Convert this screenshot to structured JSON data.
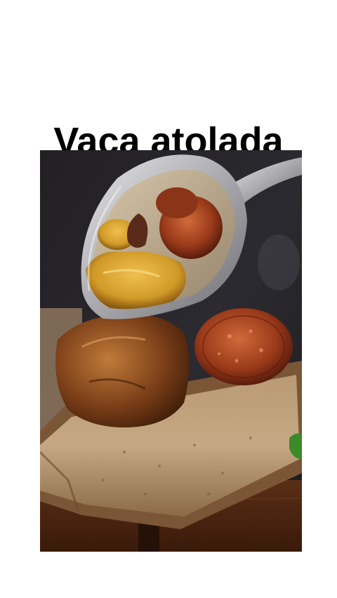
{
  "post": {
    "title": "Vaca atolada"
  },
  "photo": {
    "subject": "food-photo-stew-on-toast"
  },
  "colors": {
    "background": "#ffffff",
    "title": "#000000"
  }
}
